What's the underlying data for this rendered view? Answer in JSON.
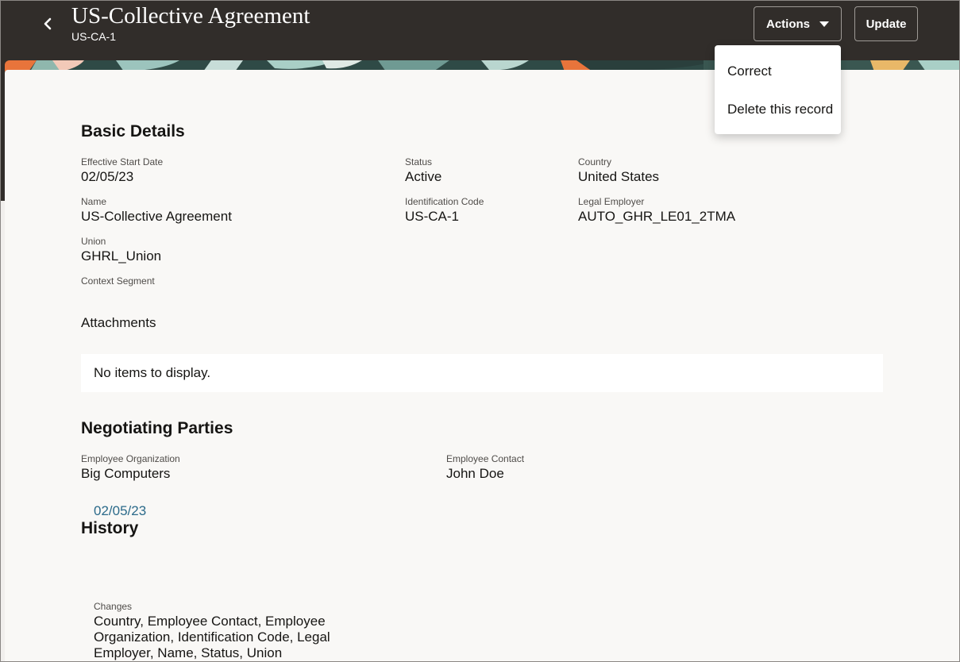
{
  "header": {
    "title": "US-Collective Agreement",
    "subtitle": "US-CA-1",
    "actions_label": "Actions",
    "update_label": "Update",
    "back_icon": "chevron-left-icon"
  },
  "actions_menu": {
    "items": [
      {
        "label": "Correct"
      },
      {
        "label": "Delete this record"
      }
    ]
  },
  "basic_details": {
    "title": "Basic Details",
    "fields": {
      "effective_start_date": {
        "label": "Effective Start Date",
        "value": "02/05/23"
      },
      "status": {
        "label": "Status",
        "value": "Active"
      },
      "country": {
        "label": "Country",
        "value": "United States"
      },
      "name": {
        "label": "Name",
        "value": "US-Collective Agreement"
      },
      "identification_code": {
        "label": "Identification Code",
        "value": "US-CA-1"
      },
      "legal_employer": {
        "label": "Legal Employer",
        "value": "AUTO_GHR_LE01_2TMA"
      },
      "union": {
        "label": "Union",
        "value": "GHRL_Union"
      },
      "context_segment": {
        "label": "Context Segment",
        "value": ""
      }
    }
  },
  "attachments": {
    "title": "Attachments",
    "empty_text": "No items to display."
  },
  "negotiating_parties": {
    "title": "Negotiating Parties",
    "employee_organization": {
      "label": "Employee Organization",
      "value": "Big Computers"
    },
    "employee_contact": {
      "label": "Employee Contact",
      "value": "John Doe"
    }
  },
  "history": {
    "title": "History",
    "entries": [
      {
        "date": "02/05/23",
        "changes_label": "Changes",
        "changes": "Country, Employee Contact, Employee Organization, Identification Code, Legal Employer, Name, Status, Union"
      }
    ]
  },
  "colors": {
    "header_bg": "#312d2a",
    "content_bg": "#f9f8f6",
    "link": "#2b6a8a"
  }
}
